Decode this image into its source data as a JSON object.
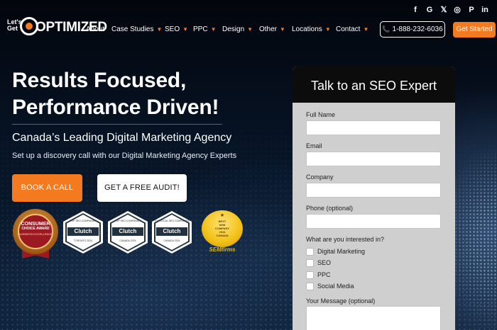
{
  "logo": {
    "lets_get": "Let's Get",
    "wordmark": "OPTIMIZED"
  },
  "nav": {
    "items": [
      {
        "label": "About",
        "has_caret": false
      },
      {
        "label": "Case Studies",
        "has_caret": true
      },
      {
        "label": "SEO",
        "has_caret": true
      },
      {
        "label": "PPC",
        "has_caret": true
      },
      {
        "label": "Design",
        "has_caret": true
      },
      {
        "label": "Other",
        "has_caret": true
      },
      {
        "label": "Locations",
        "has_caret": true
      },
      {
        "label": "Contact",
        "has_caret": true
      }
    ],
    "caret_glyph": "▼"
  },
  "social": [
    {
      "icon": "facebook-icon",
      "glyph": "f"
    },
    {
      "icon": "google-icon",
      "glyph": "G"
    },
    {
      "icon": "x-icon",
      "glyph": "𝕏"
    },
    {
      "icon": "instagram-icon",
      "glyph": "◎"
    },
    {
      "icon": "pinterest-icon",
      "glyph": "P"
    },
    {
      "icon": "linkedin-icon",
      "glyph": "in"
    }
  ],
  "header": {
    "phone": "1-888-232-6036",
    "phone_icon": "📞",
    "get_started": "Get Started"
  },
  "hero": {
    "title_line1": "Results Focused,",
    "title_line2": "Performance Driven!",
    "subtitle": "Canada’s Leading Digital Marketing Agency",
    "description": "Set up a discovery call with our Digital Marketing Agency Experts",
    "book_call": "BOOK A CALL",
    "free_audit": "GET A FREE AUDIT!"
  },
  "badges": {
    "consumer": {
      "line1": "CONSUMER",
      "line2": "CHOICE AWARD",
      "line3": "BUSINESS EXCELLENCE"
    },
    "clutch": [
      {
        "top": "TOP SEO COMPANIES",
        "name": "Clutch",
        "bottom": "TORONTO 2024"
      },
      {
        "top": "TOP SEO COMPANIES",
        "name": "Clutch",
        "bottom": "CANADA 2024"
      },
      {
        "top": "TOP LOCAL SEO COMPANIES",
        "name": "Clutch",
        "bottom": "CANADA 2024"
      }
    ],
    "semfirms": {
      "star": "★",
      "line1": "BEST",
      "line2": "SEM",
      "line3": "COMPANY",
      "line4": "2024",
      "line5": "CANADA",
      "brand": "SEMfirms"
    }
  },
  "form": {
    "title": "Talk to an SEO Expert",
    "fields": [
      {
        "label": "Full Name",
        "value": ""
      },
      {
        "label": "Email",
        "value": ""
      },
      {
        "label": "Company",
        "value": ""
      },
      {
        "label": "Phone (optional)",
        "value": ""
      }
    ],
    "interest_label": "What are you interested in?",
    "interests": [
      {
        "label": "Digital Marketing",
        "checked": false
      },
      {
        "label": "SEO",
        "checked": false
      },
      {
        "label": "PPC",
        "checked": false
      },
      {
        "label": "Social Media",
        "checked": false
      }
    ],
    "message_label": "Your Message (optional)",
    "message_value": ""
  }
}
